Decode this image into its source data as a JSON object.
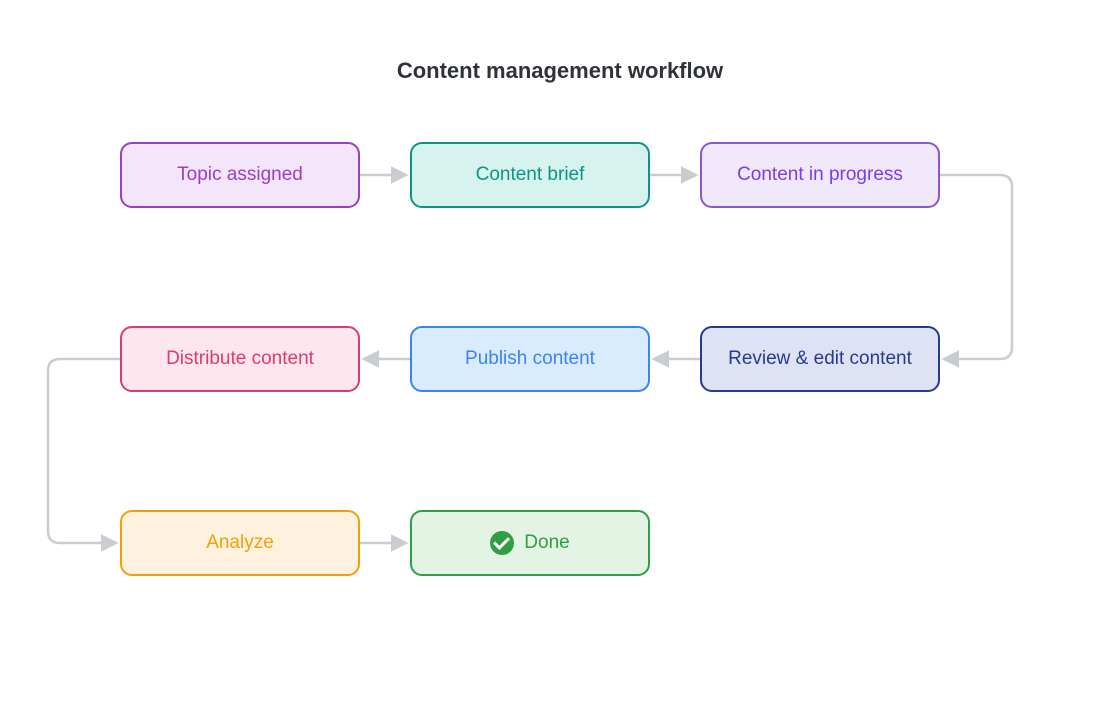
{
  "title": "Content management workflow",
  "nodes": {
    "topic_assigned": {
      "label": "Topic assigned",
      "border": "#9b3dc7",
      "fill": "#f3e6fb",
      "text": "#9b3dc7"
    },
    "content_brief": {
      "label": "Content brief",
      "border": "#0d9488",
      "fill": "#d6f3ee",
      "text": "#0d9488"
    },
    "content_in_progress": {
      "label": "Content in progress",
      "border": "#8a56d6",
      "fill": "#f1e9fb",
      "text": "#7c3aed"
    },
    "review_edit": {
      "label": "Review & edit content",
      "border": "#273a8c",
      "fill": "#dde3f4",
      "text": "#273a8c"
    },
    "publish": {
      "label": "Publish content",
      "border": "#3b82f6",
      "fill": "#d9ecfd",
      "text": "#3b82f6"
    },
    "distribute": {
      "label": "Distribute content",
      "border": "#e03a6a",
      "fill": "#fde6ee",
      "text": "#e03a6a"
    },
    "analyze": {
      "label": "Analyze",
      "border": "#f59e0b",
      "fill": "#fef2df",
      "text": "#f59e0b"
    },
    "done": {
      "label": "Done",
      "border": "#2f9e44",
      "fill": "#e3f4e4",
      "text": "#2f9e44"
    }
  },
  "flow_order": [
    "topic_assigned",
    "content_brief",
    "content_in_progress",
    "review_edit",
    "publish",
    "distribute",
    "analyze",
    "done"
  ],
  "colors": {
    "connector": "#c9ccd1",
    "title": "#2f3337"
  }
}
